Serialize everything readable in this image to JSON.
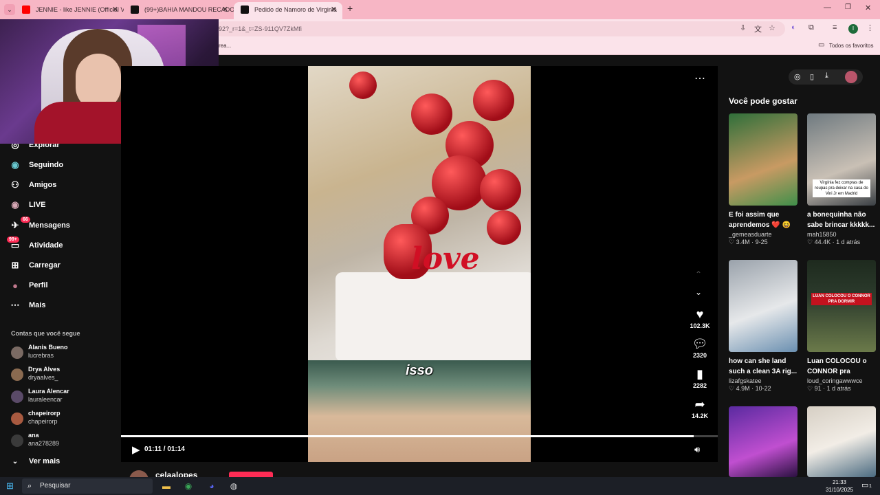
{
  "browser": {
    "tabs": [
      {
        "title": "JENNIE - like JENNIE (Official V",
        "favicon_color": "#ff0000"
      },
      {
        "title": "(99+)BAHIA MANDOU RECADO",
        "favicon_color": "#111111"
      },
      {
        "title": "Pedido de Namoro de Virginia",
        "favicon_color": "#111111"
      }
    ],
    "url": "92?_r=1&_t=ZS-911QV7ZkMfi",
    "bookmark_left": "rea...",
    "all_favorites": "Todos os favoritos",
    "profile_initial": "I"
  },
  "nav": {
    "items": [
      {
        "label": "Explorar",
        "icon": "compass-icon",
        "glyph": "◎"
      },
      {
        "label": "Seguindo",
        "icon": "following-icon",
        "glyph": "◉"
      },
      {
        "label": "Amigos",
        "icon": "friends-icon",
        "glyph": "👥"
      },
      {
        "label": "LIVE",
        "icon": "live-icon",
        "glyph": "◉"
      },
      {
        "label": "Mensagens",
        "icon": "messages-icon",
        "glyph": "✉",
        "badge": "66"
      },
      {
        "label": "Atividade",
        "icon": "activity-icon",
        "glyph": "✉",
        "badge": "99+"
      },
      {
        "label": "Carregar",
        "icon": "upload-icon",
        "glyph": "⊞"
      },
      {
        "label": "Perfil",
        "icon": "profile-icon",
        "glyph": "●"
      },
      {
        "label": "Mais",
        "icon": "more-icon",
        "glyph": "⋯"
      }
    ],
    "following_title": "Contas que você segue",
    "accounts": [
      {
        "name": "Alanis Bueno",
        "user": "lucrebras"
      },
      {
        "name": "Drya Alves",
        "user": "dryaalves_"
      },
      {
        "name": "Laura Alencar",
        "user": "lauraleencar"
      },
      {
        "name": "chapeirorp",
        "user": "chapeirorp"
      },
      {
        "name": "ana",
        "user": "ana278289"
      }
    ],
    "see_more": "Ver mais"
  },
  "video": {
    "caption": "isso",
    "time": "01:11 / 01:14",
    "progress": 0.96,
    "love_text": "love",
    "author": "celaalopes"
  },
  "actions": [
    {
      "icon": "heart-icon",
      "glyph": "♥",
      "count": "102.3K"
    },
    {
      "icon": "comment-icon",
      "glyph": "●",
      "count": "2320"
    },
    {
      "icon": "bookmark-icon",
      "glyph": "▮",
      "count": "2282"
    },
    {
      "icon": "share-icon",
      "glyph": "➦",
      "count": "14.2K"
    }
  ],
  "recommended": {
    "title": "Você pode gostar",
    "cards": [
      {
        "title": "E foi assim que aprendemos ❤️ 😆 ...",
        "author": "_gemeasduarte",
        "stats": "♡ 3.4M · 9-25",
        "thumb_colors": [
          "#2f6f3a",
          "#c89a63"
        ],
        "overlay": ""
      },
      {
        "title": "a bonequinha não sabe brincar kkkkk...",
        "author": "mah15850",
        "stats": "♡ 44.4K · 1 d atrás",
        "thumb_colors": [
          "#6f7a80",
          "#c9c0b5"
        ],
        "overlay": "Virgínia fez compras de roupas pra deixar na casa do Vini Jr em Madrid"
      },
      {
        "title": "how can she land such a clean 3A rig...",
        "author": "lizafgskatee",
        "stats": "♡ 4.9M · 10-22",
        "thumb_colors": [
          "#9aa2ab",
          "#e6e8ea"
        ],
        "overlay": ""
      },
      {
        "title": "Luan COLOCOU o CONNOR pra dormi...",
        "author": "loud_coringawwwce",
        "stats": "♡ 91 · 1 d atrás",
        "thumb_colors": [
          "#2c3b2c",
          "#6b7a4a"
        ],
        "overlay": "LUAN COLOCOU O CONNOR PRA DORMIR"
      },
      {
        "title": "",
        "author": "",
        "stats": "",
        "thumb_colors": [
          "#5a2aa0",
          "#c04fd0"
        ],
        "overlay": ""
      },
      {
        "title": "",
        "author": "",
        "stats": "",
        "thumb_colors": [
          "#d6cfc4",
          "#f2ede6"
        ],
        "overlay": ""
      }
    ]
  },
  "taskbar": {
    "search": "Pesquisar",
    "time": "21:33",
    "date": "31/10/2025",
    "notif": "1"
  }
}
